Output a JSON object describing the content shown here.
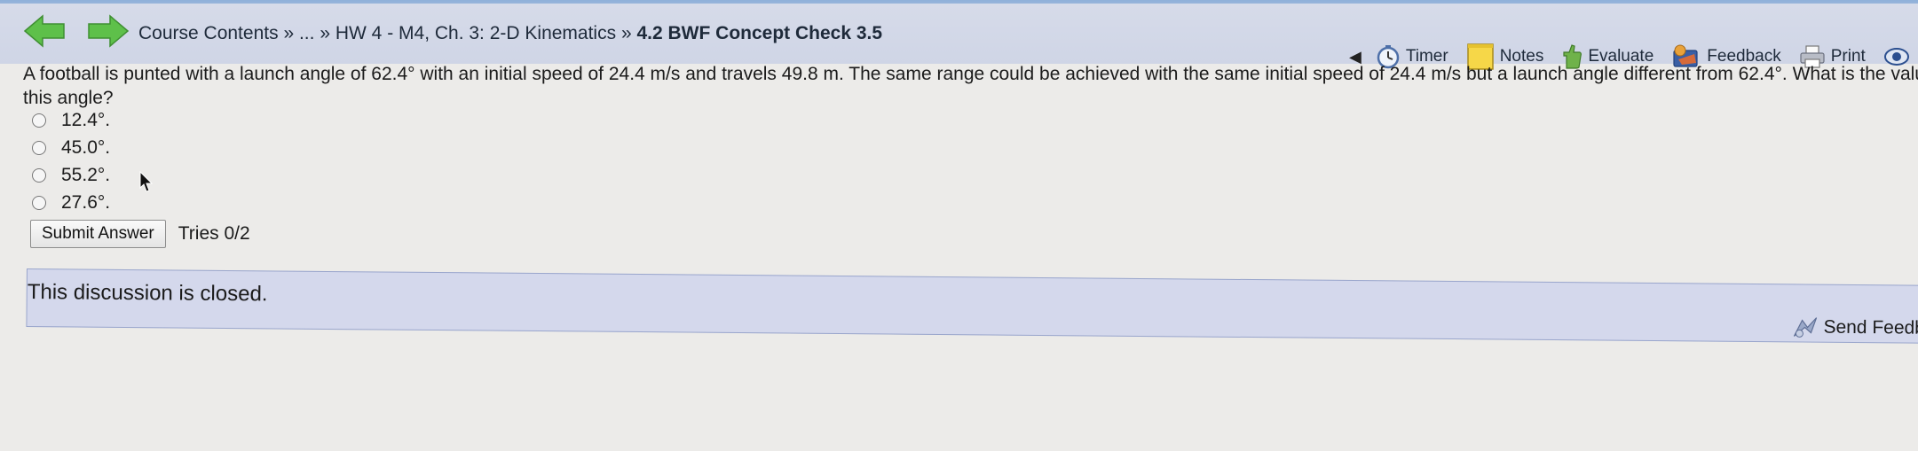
{
  "breadcrumb": {
    "items": [
      "Course Contents",
      "...",
      "HW 4 - M4, Ch. 3: 2-D Kinematics"
    ],
    "separator": "»",
    "current": "4.2 BWF Concept Check 3.5"
  },
  "toolbar": {
    "timer": "Timer",
    "notes": "Notes",
    "evaluate": "Evaluate",
    "feedback": "Feedback",
    "print": "Print"
  },
  "question": {
    "text": "A football is punted with a launch angle of 62.4° with an initial speed of 24.4 m/s and travels 49.8 m. The same range could be achieved with the same initial speed of 24.4 m/s but a launch angle different from 62.4°. What is the value of this angle?"
  },
  "options": [
    "12.4°.",
    "45.0°.",
    "55.2°.",
    "27.6°."
  ],
  "submit": {
    "label": "Submit Answer",
    "tries": "Tries 0/2"
  },
  "discussion": {
    "closed_text": "This discussion is closed.",
    "send_feedback": "Send Feedback"
  },
  "colors": {
    "header_bg": "#d6dbe9",
    "discussion_bg": "#d4d8ec",
    "nav_arrow": "#5ec04a",
    "page_bg": "#ecebe9"
  },
  "icons": [
    "back-arrow-icon",
    "forward-arrow-icon",
    "collapse-arrow-icon",
    "timer-icon",
    "notes-icon",
    "evaluate-icon",
    "feedback-icon",
    "print-icon",
    "eye-icon",
    "send-feedback-icon"
  ]
}
